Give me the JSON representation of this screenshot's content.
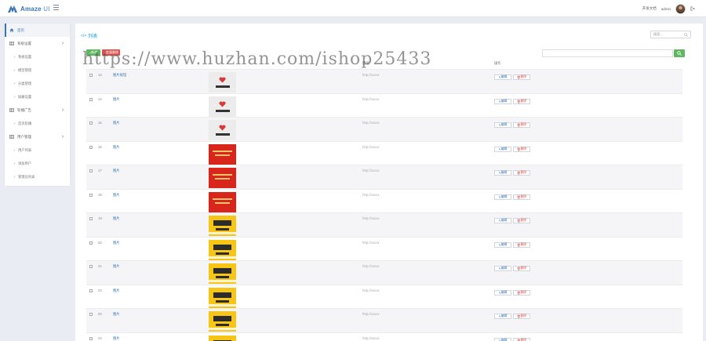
{
  "header": {
    "logo_brand": "Amaze",
    "logo_suffix": "UI",
    "top_link": "开发文档",
    "username": "admin"
  },
  "sidebar": {
    "items": [
      {
        "label": "首页",
        "type": "item",
        "icon": "home-icon",
        "active": true
      },
      {
        "label": "系统设置",
        "type": "item",
        "icon": "table-icon",
        "chevron": true
      },
      {
        "label": "系统设置",
        "type": "sub"
      },
      {
        "label": "模型管理",
        "type": "sub"
      },
      {
        "label": "分类管理",
        "type": "sub"
      },
      {
        "label": "屏蔽设置",
        "type": "sub"
      },
      {
        "label": "轮播广告",
        "type": "item",
        "icon": "table-icon",
        "chevron": true
      },
      {
        "label": "首页轮播",
        "type": "sub"
      },
      {
        "label": "用户管理",
        "type": "item",
        "icon": "table-icon",
        "chevron": true
      },
      {
        "label": "用户列表",
        "type": "sub"
      },
      {
        "label": "添加用户",
        "type": "sub"
      },
      {
        "label": "管理员列表",
        "type": "sub"
      }
    ]
  },
  "panel": {
    "title": "列表",
    "search_placeholder": "搜索...",
    "add_label": "新增",
    "batch_delete_label": "批量删除",
    "columns": {
      "op": "操作",
      "url": "链接"
    }
  },
  "watermark": "https://www.huzhan.com/ishop25433",
  "rows": [
    {
      "id": "13",
      "name": "图片按钮",
      "url": "http://xxxxx",
      "thumb": "grey"
    },
    {
      "id": "14",
      "name": "图片",
      "url": "http://xxxxx",
      "thumb": "grey"
    },
    {
      "id": "15",
      "name": "图片",
      "url": "http://xxxxx",
      "thumb": "grey"
    },
    {
      "id": "16",
      "name": "图片",
      "url": "http://xxxxx",
      "thumb": "red"
    },
    {
      "id": "17",
      "name": "图片",
      "url": "http://xxxxx",
      "thumb": "red"
    },
    {
      "id": "18",
      "name": "图片",
      "url": "http://xxxxx",
      "thumb": "red"
    },
    {
      "id": "19",
      "name": "图片",
      "url": "http://xxxxx",
      "thumb": "yellow"
    },
    {
      "id": "20",
      "name": "图片",
      "url": "http://xxxxx",
      "thumb": "yellow"
    },
    {
      "id": "21",
      "name": "图片",
      "url": "http://xxxxx",
      "thumb": "yellow"
    },
    {
      "id": "22",
      "name": "图片",
      "url": "http://xxxxx",
      "thumb": "yellow"
    },
    {
      "id": "23",
      "name": "图片",
      "url": "http://xxxxx",
      "thumb": "yellow"
    },
    {
      "id": "24",
      "name": "图片",
      "url": "http://xxxxx",
      "thumb": "yellow"
    }
  ],
  "row_actions": {
    "edit": "编辑",
    "delete": "删除"
  },
  "colors": {
    "accent": "#3b75b2",
    "success": "#5eb95e",
    "danger": "#dd514c",
    "title": "#1aa2d6"
  }
}
